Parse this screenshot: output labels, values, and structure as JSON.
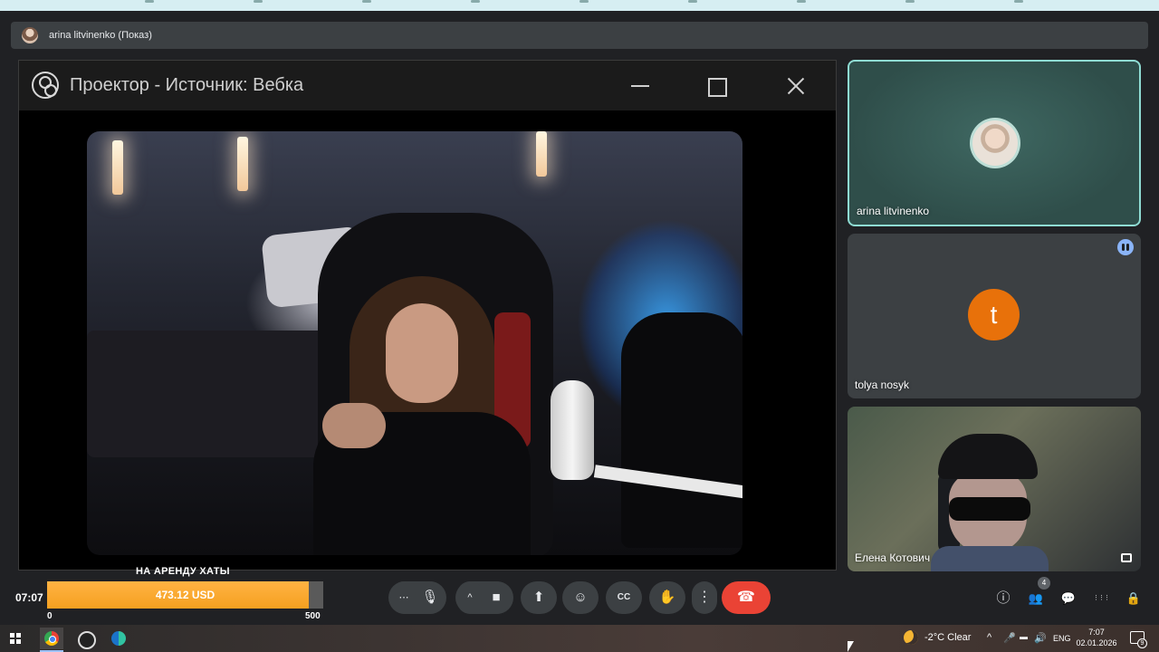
{
  "presenting_bar": {
    "label": "arina litvinenko (Показ)"
  },
  "projector": {
    "title": "Проектор - Источник: Вебка"
  },
  "tiles": [
    {
      "name": "arina litvinenko",
      "active_speaker": true
    },
    {
      "name": "tolya nosyk",
      "avatar_letter": "t",
      "avatar_color": "#e8710a"
    },
    {
      "name": "Елена Котович"
    }
  ],
  "call": {
    "clock": "07:07"
  },
  "donation_goal": {
    "title": "НА АРЕНДУ ХАТЫ",
    "amount_label": "473.12 USD",
    "current": 473.12,
    "min_label": "0",
    "max_label": "500",
    "min": 0,
    "max": 500,
    "fill_color": "#f5a020"
  },
  "controls": {
    "more_options_icon": "⋯",
    "mic_icon": "🎙",
    "chevron_icon": "^",
    "camera_icon": "■",
    "present_icon": "⬆",
    "emoji_icon": "☺",
    "captions_icon": "CC",
    "hand_icon": "✋",
    "kebab_icon": "⋮",
    "end_call_icon": "☎",
    "info_icon": "ⓘ",
    "people_icon": "👥",
    "people_count": "4",
    "chat_icon": "💬",
    "apps_icon": "⋮⋮⋮",
    "lock_icon": "🔒"
  },
  "taskbar": {
    "weather": "-2°C  Clear",
    "language": "ENG",
    "tray_chevron": "^",
    "time": "7:07",
    "date": "02.01.2026",
    "notification_count": "9"
  }
}
